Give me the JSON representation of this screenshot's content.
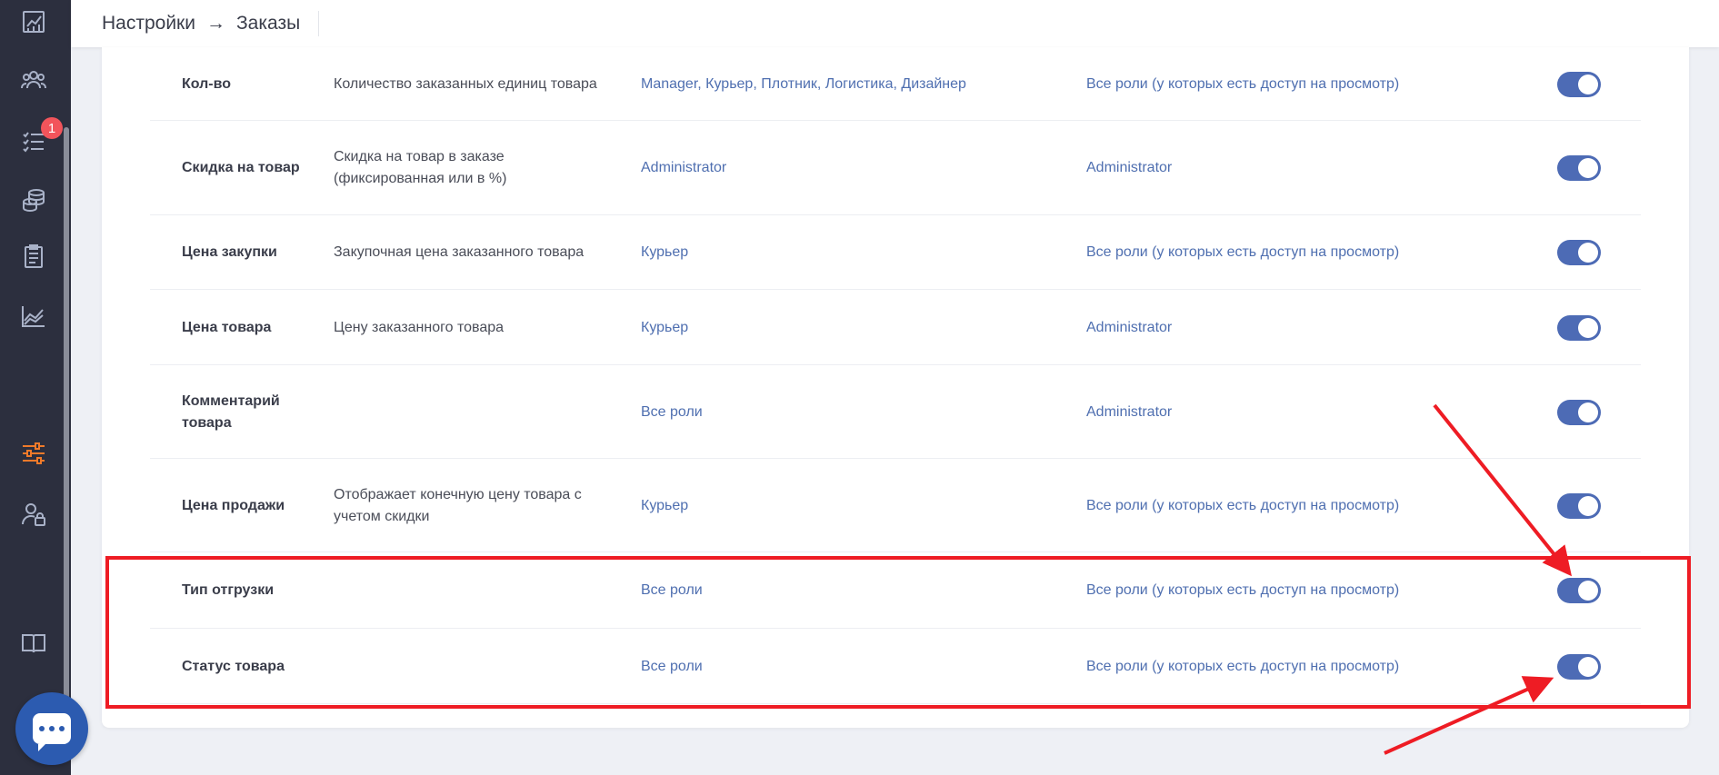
{
  "sidebar": {
    "items": [
      {
        "icon": "analytics-icon"
      },
      {
        "icon": "users-group-icon"
      },
      {
        "icon": "tasks-list-icon",
        "badge": "1"
      },
      {
        "icon": "finance-coins-icon"
      },
      {
        "icon": "clipboard-icon"
      },
      {
        "icon": "area-chart-icon"
      },
      {
        "icon": "settings-sliders-icon",
        "active": true
      },
      {
        "icon": "user-lock-icon"
      },
      {
        "icon": "book-icon"
      }
    ],
    "active_color": "#f07a2a",
    "icon_color": "#a9b2c8"
  },
  "header": {
    "breadcrumb": [
      "Настройки",
      "Заказы"
    ],
    "separator": "→"
  },
  "rows": [
    {
      "name": "Кол-во",
      "description": "Количество заказанных единиц товара",
      "edit_roles": "Manager, Курьер, Плотник, Логистика, Дизайнер",
      "view_roles": "Все роли (у которых есть доступ на просмотр)",
      "enabled": true
    },
    {
      "name": "Скидка на товар",
      "description": "Скидка на товар в заказе (фиксированная или в %)",
      "edit_roles": "Administrator",
      "view_roles": "Administrator",
      "enabled": true
    },
    {
      "name": "Цена закупки",
      "description": "Закупочная цена заказанного товара",
      "edit_roles": "Курьер",
      "view_roles": "Все роли (у которых есть доступ на просмотр)",
      "enabled": true
    },
    {
      "name": "Цена товара",
      "description": "Цену заказанного товара",
      "edit_roles": "Курьер",
      "view_roles": "Administrator",
      "enabled": true
    },
    {
      "name": "Комментарий товара",
      "description": "",
      "edit_roles": "Все роли",
      "view_roles": "Administrator",
      "enabled": true
    },
    {
      "name": "Цена продажи",
      "description": "Отображает конечную цену товара с учетом скидки",
      "edit_roles": "Курьер",
      "view_roles": "Все роли (у которых есть доступ на просмотр)",
      "enabled": true
    },
    {
      "name": "Тип отгрузки",
      "description": "",
      "edit_roles": "Все роли",
      "view_roles": "Все роли (у которых есть доступ на просмотр)",
      "enabled": true
    },
    {
      "name": "Статус товара",
      "description": "",
      "edit_roles": "Все роли",
      "view_roles": "Все роли (у которых есть доступ на просмотр)",
      "enabled": true
    }
  ],
  "colors": {
    "toggle_on": "#4d6bb5",
    "link": "#4f6fb0",
    "annotation": "#ee1c24"
  },
  "chat": {
    "icon": "chat-bubble-icon"
  }
}
